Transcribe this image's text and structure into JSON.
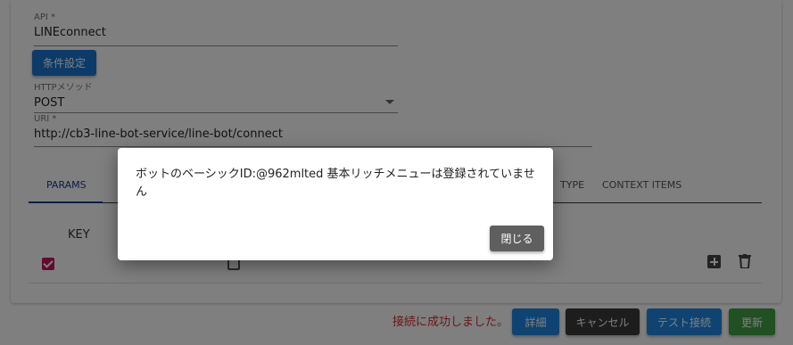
{
  "form": {
    "api": {
      "label": "API *",
      "value": "LINEconnect"
    },
    "condition_button": "条件設定",
    "http_method": {
      "label": "HTTPメソッド",
      "value": "POST"
    },
    "uri": {
      "label": "URI *",
      "value": "http://cb3-line-bot-service/line-bot/connect"
    }
  },
  "tabs": [
    {
      "label": "PARAMS",
      "active": true
    },
    {
      "label": "TYPE",
      "active": false
    },
    {
      "label": "CONTEXT ITEMS",
      "active": false
    }
  ],
  "params_table": {
    "key_header": "KEY",
    "rows": [
      {
        "enabled": true,
        "secondary_checked": false
      }
    ]
  },
  "dialog": {
    "message": "ボットのベーシックID:@962mlted 基本リッチメニューは登録されていません",
    "close_button": "閉じる"
  },
  "footer": {
    "status": "接続に成功しました。",
    "detail_button": "詳細",
    "cancel_button": "キャンセル",
    "test_button": "テスト接続",
    "update_button": "更新"
  },
  "colors": {
    "primary": "#1976d2",
    "tab_active": "#1a3a8c",
    "checkbox_checked": "#c2185b",
    "status_error_text": "#d32f2f",
    "update": "#43a047",
    "dark_button": "#3a3a3a"
  }
}
